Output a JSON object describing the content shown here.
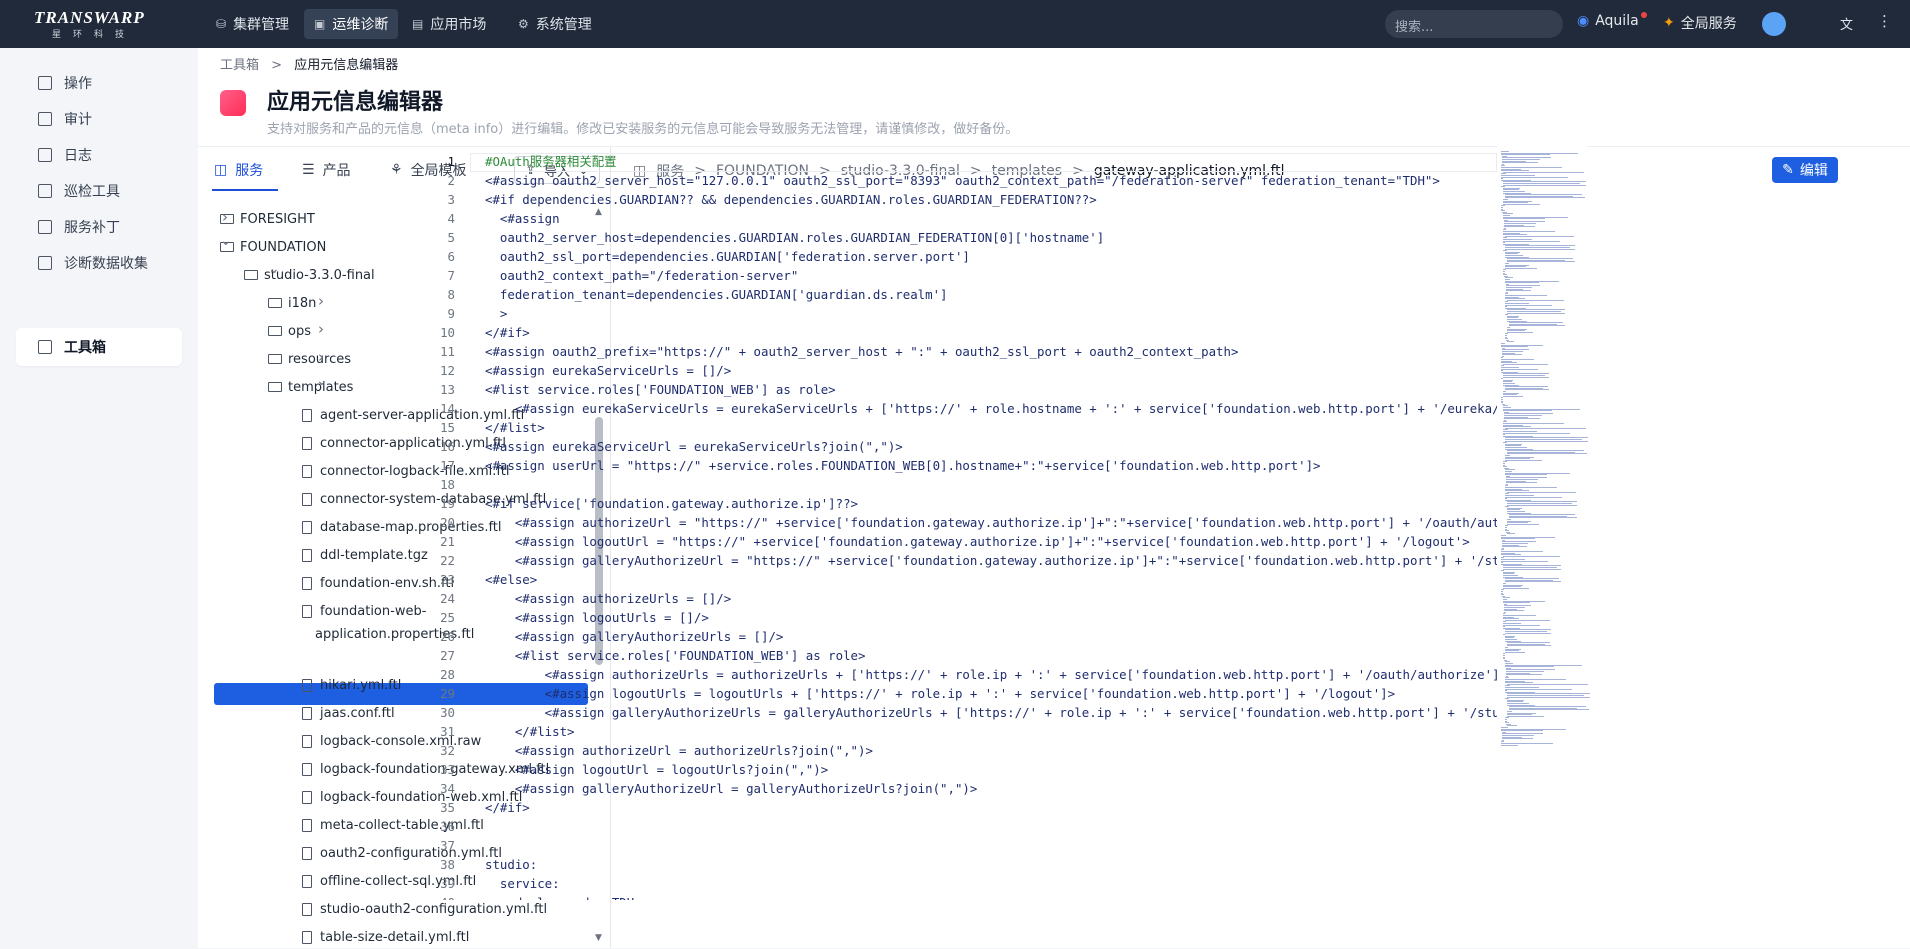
{
  "brand": {
    "name": "TRANSWARP",
    "sub": "星环科技"
  },
  "nav": [
    {
      "label": "集群管理",
      "icon": "cluster-icon"
    },
    {
      "label": "运维诊断",
      "icon": "diagnose-icon"
    },
    {
      "label": "应用市场",
      "icon": "market-icon"
    },
    {
      "label": "系统管理",
      "icon": "gear-icon"
    }
  ],
  "topright": {
    "search_placeholder": "搜索...",
    "aquila": "Aquila",
    "global_service": "全局服务"
  },
  "sidebar": [
    {
      "label": "操作"
    },
    {
      "label": "审计"
    },
    {
      "label": "日志"
    },
    {
      "label": "巡检工具"
    },
    {
      "label": "服务补丁"
    },
    {
      "label": "诊断数据收集"
    },
    {
      "label": "工具箱",
      "active": true
    }
  ],
  "breadcrumb": {
    "root": "工具箱",
    "sep": ">",
    "current": "应用元信息编辑器"
  },
  "page": {
    "title": "应用元信息编辑器",
    "desc": "支持对服务和产品的元信息（meta info）进行编辑。修改已安装服务的元信息可能会导致服务无法管理，请谨慎修改，做好备份。"
  },
  "tabs": [
    {
      "label": "服务",
      "active": true
    },
    {
      "label": "产品"
    },
    {
      "label": "全局模板"
    }
  ],
  "import_label": "导入",
  "tree": [
    {
      "label": "FORESIGHT",
      "type": "folder",
      "depth": 0,
      "chev": ">"
    },
    {
      "label": "FOUNDATION",
      "type": "folder",
      "depth": 0,
      "chev": "v"
    },
    {
      "label": "studio-3.3.0-final",
      "type": "folder",
      "depth": 1,
      "chev": "v"
    },
    {
      "label": "i18n",
      "type": "folder",
      "depth": 2,
      "chev": ">"
    },
    {
      "label": "ops",
      "type": "folder",
      "depth": 2,
      "chev": ">"
    },
    {
      "label": "resources",
      "type": "folder",
      "depth": 2,
      "chev": ">"
    },
    {
      "label": "templates",
      "type": "folder",
      "depth": 2,
      "chev": "v"
    },
    {
      "label": "agent-server-application.yml.ftl",
      "type": "file"
    },
    {
      "label": "connector-application.yml.ftl",
      "type": "file"
    },
    {
      "label": "connector-logback-file.xml.ftl",
      "type": "file"
    },
    {
      "label": "connector-system-database.yml.ftl",
      "type": "file"
    },
    {
      "label": "database-map.properties.ftl",
      "type": "file"
    },
    {
      "label": "ddl-template.tgz",
      "type": "file"
    },
    {
      "label": "foundation-env.sh.ftl",
      "type": "file"
    },
    {
      "label": "foundation-web-",
      "label2": "application.properties.ftl",
      "type": "file"
    },
    {
      "label": "gateway-application.yml.ftl",
      "type": "file",
      "selected": true
    },
    {
      "label": "hikari.yml.ftl",
      "type": "file"
    },
    {
      "label": "jaas.conf.ftl",
      "type": "file"
    },
    {
      "label": "logback-console.xml.raw",
      "type": "file"
    },
    {
      "label": "logback-foundation-gateway.xml.ftl",
      "type": "file"
    },
    {
      "label": "logback-foundation-web.xml.ftl",
      "type": "file"
    },
    {
      "label": "meta-collect-table.yml.ftl",
      "type": "file"
    },
    {
      "label": "oauth2-configuration.yml.ftl",
      "type": "file"
    },
    {
      "label": "offline-collect-sql.yml.ftl",
      "type": "file"
    },
    {
      "label": "studio-oauth2-configuration.yml.ftl",
      "type": "file"
    },
    {
      "label": "table-size-detail.yml.ftl",
      "type": "file"
    }
  ],
  "editor_path": [
    "服务",
    "FOUNDATION",
    "studio-3.3.0-final",
    "templates",
    "gateway-application.yml.ftl"
  ],
  "edit_label": "编辑",
  "code_lines": [
    "#OAuth服务器相关配置",
    "<#assign oauth2_server_host=\"127.0.0.1\" oauth2_ssl_port=\"8393\" oauth2_context_path=\"/federation-server\" federation_tenant=\"TDH\">",
    "<#if dependencies.GUARDIAN?? && dependencies.GUARDIAN.roles.GUARDIAN_FEDERATION??>",
    "  <#assign",
    "  oauth2_server_host=dependencies.GUARDIAN.roles.GUARDIAN_FEDERATION[0]['hostname']",
    "  oauth2_ssl_port=dependencies.GUARDIAN['federation.server.port']",
    "  oauth2_context_path=\"/federation-server\"",
    "  federation_tenant=dependencies.GUARDIAN['guardian.ds.realm']",
    "  >",
    "</#if>",
    "<#assign oauth2_prefix=\"https://\" + oauth2_server_host + \":\" + oauth2_ssl_port + oauth2_context_path>",
    "<#assign eurekaServiceUrls = []/>",
    "<#list service.roles['FOUNDATION_WEB'] as role>",
    "    <#assign eurekaServiceUrls = eurekaServiceUrls + ['https://' + role.hostname + ':' + service['foundation.web.http.port'] + '/eureka/']>",
    "</#list>",
    "<#assign eurekaServiceUrl = eurekaServiceUrls?join(\",\")>",
    "<#assign userUrl = \"https://\" +service.roles.FOUNDATION_WEB[0].hostname+\":\"+service['foundation.web.http.port']>",
    "",
    "<#if service['foundation.gateway.authorize.ip']??>",
    "    <#assign authorizeUrl = \"https://\" +service['foundation.gateway.authorize.ip']+\":\"+service['foundation.web.http.port'] + '/oauth/authorize",
    "    <#assign logoutUrl = \"https://\" +service['foundation.gateway.authorize.ip']+\":\"+service['foundation.web.http.port'] + '/logout'>",
    "    <#assign galleryAuthorizeUrl = \"https://\" +service['foundation.gateway.authorize.ip']+\":\"+service['foundation.web.http.port'] + '/studio/a",
    "<#else>",
    "    <#assign authorizeUrls = []/>",
    "    <#assign logoutUrls = []/>",
    "    <#assign galleryAuthorizeUrls = []/>",
    "    <#list service.roles['FOUNDATION_WEB'] as role>",
    "        <#assign authorizeUrls = authorizeUrls + ['https://' + role.ip + ':' + service['foundation.web.http.port'] + '/oauth/authorize']>",
    "        <#assign logoutUrls = logoutUrls + ['https://' + role.ip + ':' + service['foundation.web.http.port'] + '/logout']>",
    "        <#assign galleryAuthorizeUrls = galleryAuthorizeUrls + ['https://' + role.ip + ':' + service['foundation.web.http.port'] + '/studio/ap",
    "    </#list>",
    "    <#assign authorizeUrl = authorizeUrls?join(\",\")>",
    "    <#assign logoutUrl = logoutUrls?join(\",\")>",
    "    <#assign galleryAuthorizeUrl = galleryAuthorizeUrls?join(\",\")>",
    "</#if>",
    "",
    "",
    "studio:",
    "  service:",
    "    deploy-mode: TDH"
  ]
}
